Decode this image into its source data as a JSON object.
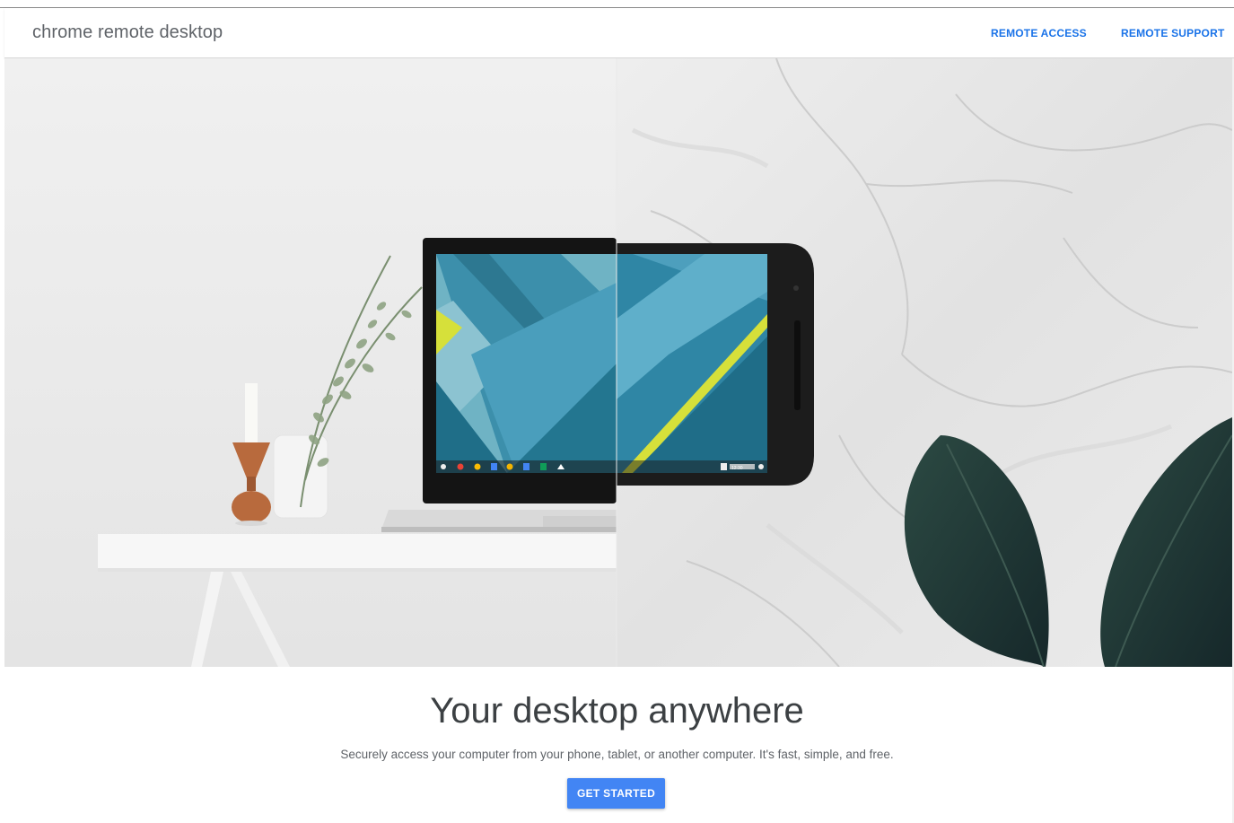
{
  "header": {
    "brand": "chrome remote desktop",
    "nav": {
      "remote_access": "REMOTE ACCESS",
      "remote_support": "REMOTE SUPPORT"
    }
  },
  "hero": {
    "laptop_shelf_icons": [
      "search-icon",
      "chrome-icon",
      "drive-icon",
      "docs-icon",
      "photos-icon",
      "sheets-icon",
      "hangouts-icon",
      "chevron-up-icon"
    ],
    "phone_status_time": "12:30"
  },
  "main": {
    "headline": "Your desktop anywhere",
    "subline": "Securely access your computer from your phone, tablet, or another computer. It's fast, simple, and free.",
    "cta_label": "GET STARTED"
  },
  "colors": {
    "accent": "#4285f4",
    "link": "#1a73e8",
    "wallpaper_teal": "#2a7f99",
    "wallpaper_yellow": "#d6e03a",
    "leaf": "#223b35"
  }
}
